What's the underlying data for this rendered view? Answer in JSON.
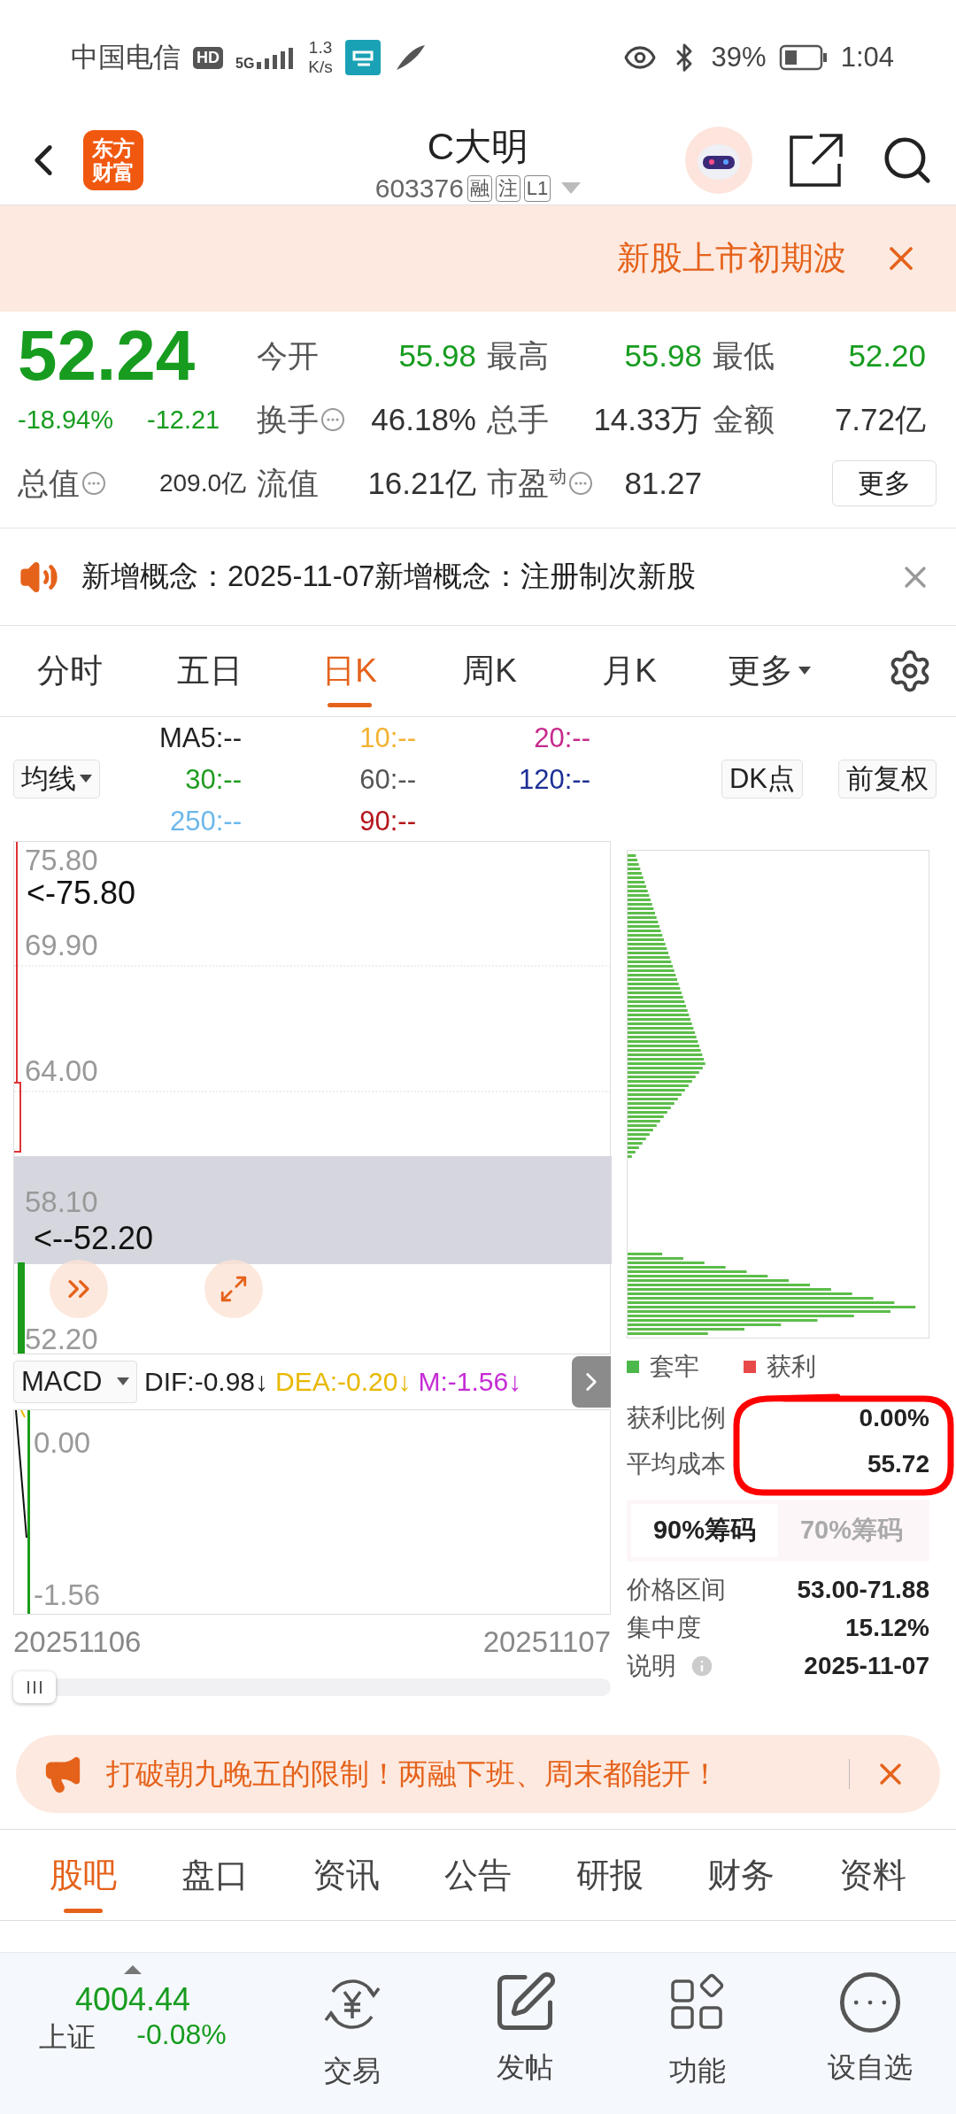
{
  "status_bar": {
    "carrier": "中国电信",
    "hd": "HD",
    "network": "5G",
    "speed": [
      "1.3",
      "K/s"
    ],
    "battery": "39%",
    "time": "1:04"
  },
  "header": {
    "logo": [
      "东方",
      "财富"
    ],
    "title": "C大明",
    "code": "603376",
    "tags": [
      "融",
      "注",
      "L1"
    ]
  },
  "banner": {
    "text": "新股上市初期波"
  },
  "quote": {
    "price": "52.24",
    "change_pct": "-18.94%",
    "change": "-12.21",
    "stats": [
      {
        "label": "今开",
        "value": "55.98",
        "info": false,
        "color": "#179c1f"
      },
      {
        "label": "最高",
        "value": "55.98",
        "info": false,
        "color": "#179c1f"
      },
      {
        "label": "最低",
        "value": "52.20",
        "info": false,
        "color": "#179c1f"
      },
      {
        "label": "换手",
        "value": "46.18%",
        "info": true,
        "color": "#333333"
      },
      {
        "label": "总手",
        "value": "14.33万",
        "info": false,
        "color": "#333333"
      },
      {
        "label": "金额",
        "value": "7.72亿",
        "info": false,
        "color": "#333333"
      },
      {
        "label": "总值",
        "value": "209.0亿",
        "info": true,
        "color": "#333333"
      },
      {
        "label": "流值",
        "value": "16.21亿",
        "info": false,
        "color": "#333333"
      },
      {
        "label": "市盈$^{动}$",
        "value": "81.27",
        "info": true,
        "color": "#333333"
      }
    ],
    "more_button": "更多"
  },
  "notice": {
    "text": "新增概念：2025-11-07新增概念：注册制次新股"
  },
  "chart_tabs": [
    {
      "label": "分时",
      "selected": false,
      "dropdown": false
    },
    {
      "label": "五日",
      "selected": false,
      "dropdown": false
    },
    {
      "label": "日K",
      "selected": true,
      "dropdown": false
    },
    {
      "label": "周K",
      "selected": false,
      "dropdown": false
    },
    {
      "label": "月K",
      "selected": false,
      "dropdown": false
    },
    {
      "label": "更多",
      "selected": false,
      "dropdown": true
    }
  ],
  "ma": {
    "selector": "均线",
    "lines": [
      {
        "label": "MA5:--",
        "color": "#222222"
      },
      {
        "label": "10:--",
        "color": "#f2b230"
      },
      {
        "label": "20:--",
        "color": "#c62a8c"
      },
      {
        "label": "30:--",
        "color": "#1f9c1f"
      },
      {
        "label": "60:--",
        "color": "#555555"
      },
      {
        "label": "120:--",
        "color": "#1c2f96"
      },
      {
        "label": "250:--",
        "color": "#6cb8ea"
      },
      {
        "label": "90:--",
        "color": "#b3151c"
      }
    ],
    "buttons": [
      "DK点",
      "前复权"
    ]
  },
  "kline": {
    "y_labels": [
      "75.80",
      "69.90",
      "64.00",
      "58.10",
      "52.20"
    ],
    "high_marker": "<-75.80",
    "low_marker": "<--52.20"
  },
  "macd": {
    "selector": "MACD",
    "values": [
      {
        "label": "DIF:-0.98↓",
        "color": "#222222"
      },
      {
        "label": "DEA:-0.20↓",
        "color": "#e8b800"
      },
      {
        "label": "M:-1.56↓",
        "color": "#c52bd6"
      }
    ],
    "y_labels": [
      "0.00",
      "-1.56"
    ],
    "dates": [
      "20251106",
      "20251107"
    ]
  },
  "chips": {
    "legend": [
      {
        "label": "套牢",
        "color": "#4cb84c"
      },
      {
        "label": "获利",
        "color": "#e84a4a"
      }
    ],
    "stats": [
      {
        "label": "获利比例",
        "value": "0.00%"
      },
      {
        "label": "平均成本",
        "value": "55.72"
      }
    ],
    "tabs": [
      {
        "label": "90%筹码",
        "selected": true
      },
      {
        "label": "70%筹码",
        "selected": false
      }
    ],
    "details": [
      {
        "label": "价格区间",
        "value": "53.00-71.88",
        "info": false
      },
      {
        "label": "集中度",
        "value": "15.12%",
        "info": false
      },
      {
        "label": "说明",
        "value": "2025-11-07",
        "info": true
      }
    ]
  },
  "promo": {
    "text": "打破朝九晚五的限制！两融下班、周末都能开！"
  },
  "bottom_tabs": [
    {
      "label": "股吧",
      "selected": true
    },
    {
      "label": "盘口",
      "selected": false
    },
    {
      "label": "资讯",
      "selected": false
    },
    {
      "label": "公告",
      "selected": false
    },
    {
      "label": "研报",
      "selected": false
    },
    {
      "label": "财务",
      "selected": false
    },
    {
      "label": "资料",
      "selected": false
    }
  ],
  "nav": {
    "index": {
      "value": "4004.44",
      "name": "上证",
      "change": "-0.08%"
    },
    "items": [
      {
        "kind": "trade",
        "label": "交易"
      },
      {
        "kind": "post",
        "label": "发帖"
      },
      {
        "kind": "functions",
        "label": "功能"
      },
      {
        "kind": "watchlist",
        "label": "设自选"
      }
    ]
  }
}
